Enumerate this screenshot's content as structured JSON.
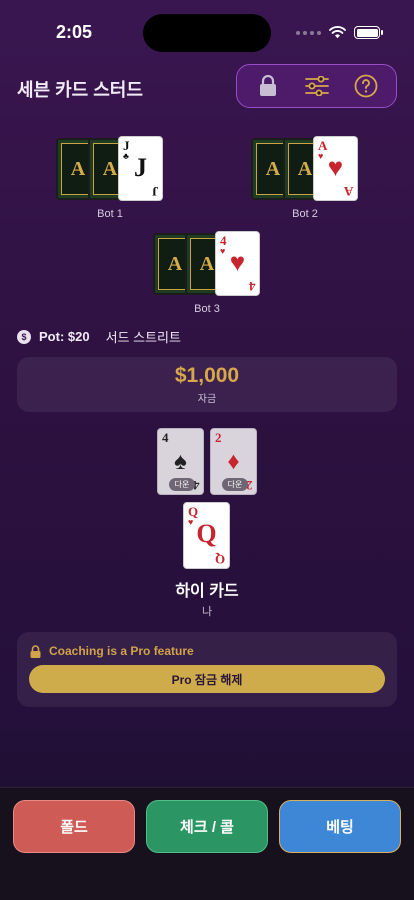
{
  "status_bar": {
    "time": "2:05"
  },
  "header": {
    "title": "세븐 카드 스터드"
  },
  "toolbar": {
    "lock_icon": "lock-icon",
    "settings_icon": "sliders-icon",
    "help_icon": "help-icon"
  },
  "card_back_letter": "A",
  "bots": [
    {
      "name": "Bot 1",
      "up_card": {
        "rank": "J",
        "suit": "♣",
        "color": "black"
      }
    },
    {
      "name": "Bot 2",
      "up_card": {
        "rank": "A",
        "suit": "♥",
        "color": "red"
      }
    },
    {
      "name": "Bot 3",
      "up_card": {
        "rank": "4",
        "suit": "♥",
        "color": "red"
      }
    }
  ],
  "pot": {
    "icon": "$",
    "label": "Pot: $20",
    "street": "서드 스트리트"
  },
  "player": {
    "chips": "$1,000",
    "chips_label": "자금",
    "hole_cards": [
      {
        "rank": "4",
        "suit": "♠",
        "color": "black",
        "badge": "다운"
      },
      {
        "rank": "2",
        "suit": "♦",
        "color": "red",
        "badge": "다운"
      }
    ],
    "up_card": {
      "rank": "Q",
      "suit": "♥",
      "color": "red"
    },
    "hand_name": "하이 카드",
    "label": "나"
  },
  "coaching": {
    "message": "Coaching is a Pro feature",
    "button_label": "Pro 잠금 해제"
  },
  "actions": {
    "fold": "폴드",
    "check_call": "체크 / 콜",
    "bet": "베팅"
  }
}
